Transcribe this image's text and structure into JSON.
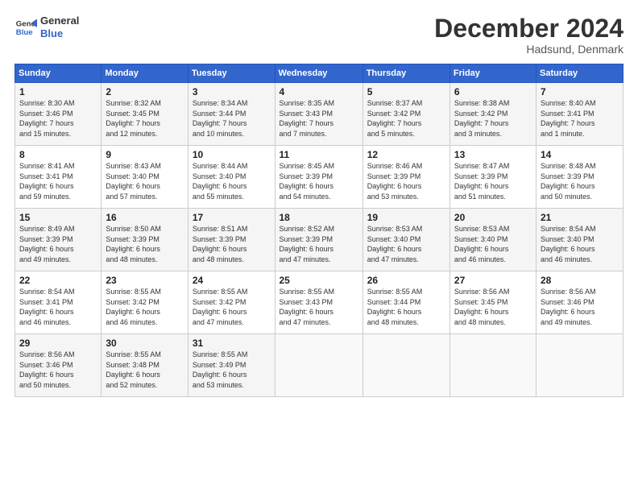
{
  "header": {
    "logo_line1": "General",
    "logo_line2": "Blue",
    "month": "December 2024",
    "location": "Hadsund, Denmark"
  },
  "days_of_week": [
    "Sunday",
    "Monday",
    "Tuesday",
    "Wednesday",
    "Thursday",
    "Friday",
    "Saturday"
  ],
  "weeks": [
    [
      {
        "day": "1",
        "info": "Sunrise: 8:30 AM\nSunset: 3:46 PM\nDaylight: 7 hours\nand 15 minutes."
      },
      {
        "day": "2",
        "info": "Sunrise: 8:32 AM\nSunset: 3:45 PM\nDaylight: 7 hours\nand 12 minutes."
      },
      {
        "day": "3",
        "info": "Sunrise: 8:34 AM\nSunset: 3:44 PM\nDaylight: 7 hours\nand 10 minutes."
      },
      {
        "day": "4",
        "info": "Sunrise: 8:35 AM\nSunset: 3:43 PM\nDaylight: 7 hours\nand 7 minutes."
      },
      {
        "day": "5",
        "info": "Sunrise: 8:37 AM\nSunset: 3:42 PM\nDaylight: 7 hours\nand 5 minutes."
      },
      {
        "day": "6",
        "info": "Sunrise: 8:38 AM\nSunset: 3:42 PM\nDaylight: 7 hours\nand 3 minutes."
      },
      {
        "day": "7",
        "info": "Sunrise: 8:40 AM\nSunset: 3:41 PM\nDaylight: 7 hours\nand 1 minute."
      }
    ],
    [
      {
        "day": "8",
        "info": "Sunrise: 8:41 AM\nSunset: 3:41 PM\nDaylight: 6 hours\nand 59 minutes."
      },
      {
        "day": "9",
        "info": "Sunrise: 8:43 AM\nSunset: 3:40 PM\nDaylight: 6 hours\nand 57 minutes."
      },
      {
        "day": "10",
        "info": "Sunrise: 8:44 AM\nSunset: 3:40 PM\nDaylight: 6 hours\nand 55 minutes."
      },
      {
        "day": "11",
        "info": "Sunrise: 8:45 AM\nSunset: 3:39 PM\nDaylight: 6 hours\nand 54 minutes."
      },
      {
        "day": "12",
        "info": "Sunrise: 8:46 AM\nSunset: 3:39 PM\nDaylight: 6 hours\nand 53 minutes."
      },
      {
        "day": "13",
        "info": "Sunrise: 8:47 AM\nSunset: 3:39 PM\nDaylight: 6 hours\nand 51 minutes."
      },
      {
        "day": "14",
        "info": "Sunrise: 8:48 AM\nSunset: 3:39 PM\nDaylight: 6 hours\nand 50 minutes."
      }
    ],
    [
      {
        "day": "15",
        "info": "Sunrise: 8:49 AM\nSunset: 3:39 PM\nDaylight: 6 hours\nand 49 minutes."
      },
      {
        "day": "16",
        "info": "Sunrise: 8:50 AM\nSunset: 3:39 PM\nDaylight: 6 hours\nand 48 minutes."
      },
      {
        "day": "17",
        "info": "Sunrise: 8:51 AM\nSunset: 3:39 PM\nDaylight: 6 hours\nand 48 minutes."
      },
      {
        "day": "18",
        "info": "Sunrise: 8:52 AM\nSunset: 3:39 PM\nDaylight: 6 hours\nand 47 minutes."
      },
      {
        "day": "19",
        "info": "Sunrise: 8:53 AM\nSunset: 3:40 PM\nDaylight: 6 hours\nand 47 minutes."
      },
      {
        "day": "20",
        "info": "Sunrise: 8:53 AM\nSunset: 3:40 PM\nDaylight: 6 hours\nand 46 minutes."
      },
      {
        "day": "21",
        "info": "Sunrise: 8:54 AM\nSunset: 3:40 PM\nDaylight: 6 hours\nand 46 minutes."
      }
    ],
    [
      {
        "day": "22",
        "info": "Sunrise: 8:54 AM\nSunset: 3:41 PM\nDaylight: 6 hours\nand 46 minutes."
      },
      {
        "day": "23",
        "info": "Sunrise: 8:55 AM\nSunset: 3:42 PM\nDaylight: 6 hours\nand 46 minutes."
      },
      {
        "day": "24",
        "info": "Sunrise: 8:55 AM\nSunset: 3:42 PM\nDaylight: 6 hours\nand 47 minutes."
      },
      {
        "day": "25",
        "info": "Sunrise: 8:55 AM\nSunset: 3:43 PM\nDaylight: 6 hours\nand 47 minutes."
      },
      {
        "day": "26",
        "info": "Sunrise: 8:55 AM\nSunset: 3:44 PM\nDaylight: 6 hours\nand 48 minutes."
      },
      {
        "day": "27",
        "info": "Sunrise: 8:56 AM\nSunset: 3:45 PM\nDaylight: 6 hours\nand 48 minutes."
      },
      {
        "day": "28",
        "info": "Sunrise: 8:56 AM\nSunset: 3:46 PM\nDaylight: 6 hours\nand 49 minutes."
      }
    ],
    [
      {
        "day": "29",
        "info": "Sunrise: 8:56 AM\nSunset: 3:46 PM\nDaylight: 6 hours\nand 50 minutes."
      },
      {
        "day": "30",
        "info": "Sunrise: 8:55 AM\nSunset: 3:48 PM\nDaylight: 6 hours\nand 52 minutes."
      },
      {
        "day": "31",
        "info": "Sunrise: 8:55 AM\nSunset: 3:49 PM\nDaylight: 6 hours\nand 53 minutes."
      },
      {
        "day": "",
        "info": ""
      },
      {
        "day": "",
        "info": ""
      },
      {
        "day": "",
        "info": ""
      },
      {
        "day": "",
        "info": ""
      }
    ]
  ]
}
